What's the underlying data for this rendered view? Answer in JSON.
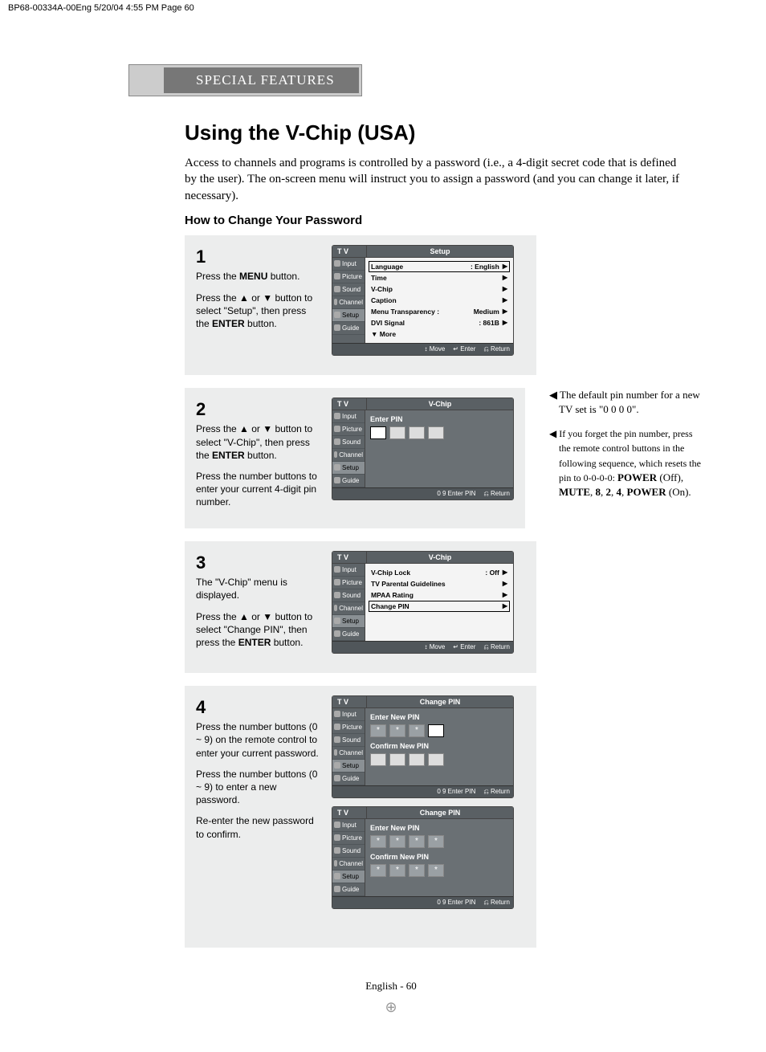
{
  "meta_strip": "BP68-00334A-00Eng  5/20/04  4:55 PM  Page 60",
  "section_header": "SPECIAL FEATURES",
  "page_title": "Using the V-Chip (USA)",
  "intro": "Access to channels and programs is controlled by a password (i.e., a 4-digit secret code that is defined by the user). The on-screen menu will instruct you to assign a password (and you can change it later, if necessary).",
  "subhead": "How to Change Your Password",
  "steps": {
    "s1": {
      "num": "1",
      "p1_a": "Press the ",
      "p1_b": "MENU",
      "p1_c": " button.",
      "p2": "Press the ▲ or ▼ button to select \"Setup\", then press the ",
      "p2_b": "ENTER",
      "p2_c": " button.",
      "osd": {
        "tab": "T V",
        "title": "Setup",
        "side": [
          "Input",
          "Picture",
          "Sound",
          "Channel",
          "Setup",
          "Guide"
        ],
        "active_side": "Setup",
        "rows": [
          {
            "label": "Language",
            "val": ": English",
            "arrow": "▶",
            "boxed": true
          },
          {
            "label": "Time",
            "val": "",
            "arrow": "▶"
          },
          {
            "label": "V-Chip",
            "val": "",
            "arrow": "▶"
          },
          {
            "label": "Caption",
            "val": "",
            "arrow": "▶"
          },
          {
            "label": "Menu Transparency :",
            "val": "Medium",
            "arrow": "▶"
          },
          {
            "label": "DVI Signal",
            "val": ": 861B",
            "arrow": "▶"
          },
          {
            "label": "▼ More",
            "val": "",
            "arrow": ""
          }
        ],
        "footer": [
          "Move",
          "Enter",
          "Return"
        ]
      }
    },
    "s2": {
      "num": "2",
      "p1": "Press the ▲ or ▼ button to select \"V-Chip\", then press the ",
      "p1_b": "ENTER",
      "p1_c": " button.",
      "p2": "Press the number buttons to enter your current 4-digit pin number.",
      "osd": {
        "tab": "T V",
        "title": "V-Chip",
        "side": [
          "Input",
          "Picture",
          "Sound",
          "Channel",
          "Setup",
          "Guide"
        ],
        "active_side": "Setup",
        "enter_label": "Enter PIN",
        "boxes": [
          "active",
          "",
          "",
          ""
        ],
        "footer": [
          "0 9 Enter PIN",
          "Return"
        ]
      },
      "notes": {
        "n1": "◀ The default pin number for a new TV set is \"0 0 0 0\".",
        "n2_pre": "◀ If you forget the pin number, press the remote control buttons in the following sequence, which resets the pin to 0-0-0-0: ",
        "n2_b1": "POWER",
        "n2_m1": " (Off), ",
        "n2_b2": "MUTE",
        "n2_m2": ", ",
        "n2_b3": "8",
        "n2_m3": ", ",
        "n2_b4": "2",
        "n2_m4": ", ",
        "n2_b5": "4",
        "n2_m5": ", ",
        "n2_b6": "POWER",
        "n2_m6": " (On)."
      }
    },
    "s3": {
      "num": "3",
      "p1": "The \"V-Chip\" menu is displayed.",
      "p2": "Press the ▲ or ▼ button to select \"Change PIN\", then press the ",
      "p2_b": "ENTER",
      "p2_c": " button.",
      "osd": {
        "tab": "T V",
        "title": "V-Chip",
        "side": [
          "Input",
          "Picture",
          "Sound",
          "Channel",
          "Setup",
          "Guide"
        ],
        "active_side": "Setup",
        "rows": [
          {
            "label": "V-Chip Lock",
            "val": ": Off",
            "arrow": "▶"
          },
          {
            "label": "TV Parental Guidelines",
            "val": "",
            "arrow": "▶"
          },
          {
            "label": "MPAA Rating",
            "val": "",
            "arrow": "▶"
          },
          {
            "label": "Change PIN",
            "val": "",
            "arrow": "▶",
            "boxed": true
          }
        ],
        "footer": [
          "Move",
          "Enter",
          "Return"
        ]
      }
    },
    "s4": {
      "num": "4",
      "p1": "Press the number buttons (0 ~ 9) on the remote control to enter your current password.",
      "p2": "Press the number buttons (0 ~ 9) to enter a new password.",
      "p3": "Re-enter the new password to confirm.",
      "osd1": {
        "tab": "T V",
        "title": "Change PIN",
        "side": [
          "Input",
          "Picture",
          "Sound",
          "Channel",
          "Setup",
          "Guide"
        ],
        "active_side": "Setup",
        "enter_label": "Enter New PIN",
        "boxes1": [
          "*",
          "*",
          "*",
          "active"
        ],
        "confirm_label": "Confirm New PIN",
        "boxes2": [
          "",
          "",
          "",
          ""
        ],
        "footer": [
          "0 9 Enter PIN",
          "Return"
        ]
      },
      "osd2": {
        "tab": "T V",
        "title": "Change PIN",
        "side": [
          "Input",
          "Picture",
          "Sound",
          "Channel",
          "Setup",
          "Guide"
        ],
        "active_side": "Setup",
        "enter_label": "Enter New PIN",
        "boxes1": [
          "*",
          "*",
          "*",
          "*"
        ],
        "confirm_label": "Confirm New PIN",
        "boxes2": [
          "*",
          "*",
          "*",
          "*"
        ],
        "footer": [
          "0 9 Enter PIN",
          "Return"
        ]
      }
    }
  },
  "footer": "English - 60"
}
